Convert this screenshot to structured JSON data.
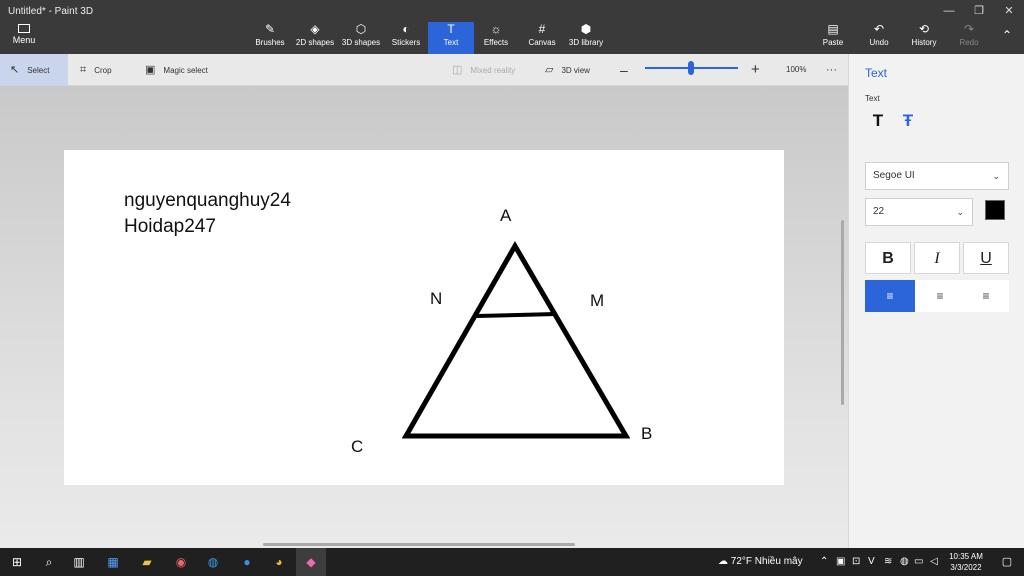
{
  "window": {
    "title": "Untitled* - Paint 3D",
    "minimize": "—",
    "maximize": "❐",
    "close": "✕"
  },
  "menu": {
    "label": "Menu"
  },
  "toolbar": {
    "brushes": "Brushes",
    "shapes2d": "2D shapes",
    "shapes3d": "3D shapes",
    "stickers": "Stickers",
    "text": "Text",
    "effects": "Effects",
    "canvas": "Canvas",
    "library3d": "3D library",
    "paste": "Paste",
    "undo": "Undo",
    "history": "History",
    "redo": "Redo"
  },
  "subbar": {
    "select": "Select",
    "crop": "Crop",
    "magic_select": "Magic select",
    "mixed_reality": "Mixed reality",
    "view3d": "3D view",
    "zoom": "100%",
    "zoom_value_percent": 100
  },
  "canvas": {
    "text_line1": "nguyenquanghuy24",
    "text_line2": "Hoidap247",
    "labels": {
      "A": "A",
      "B": "B",
      "C": "C",
      "M": "M",
      "N": "N"
    }
  },
  "panel": {
    "title": "Text",
    "section": "Text",
    "font": "Segoe UI",
    "size": "22",
    "color": "#000000",
    "bold": "B",
    "italic": "I",
    "underline": "U"
  },
  "taskbar": {
    "weather": "72°F  Nhiều mây",
    "time": "10:35 AM",
    "date": "3/3/2022"
  },
  "colors": {
    "accent": "#2b65d9",
    "titlebar": "#3a3a3a",
    "taskbar": "#202020"
  }
}
